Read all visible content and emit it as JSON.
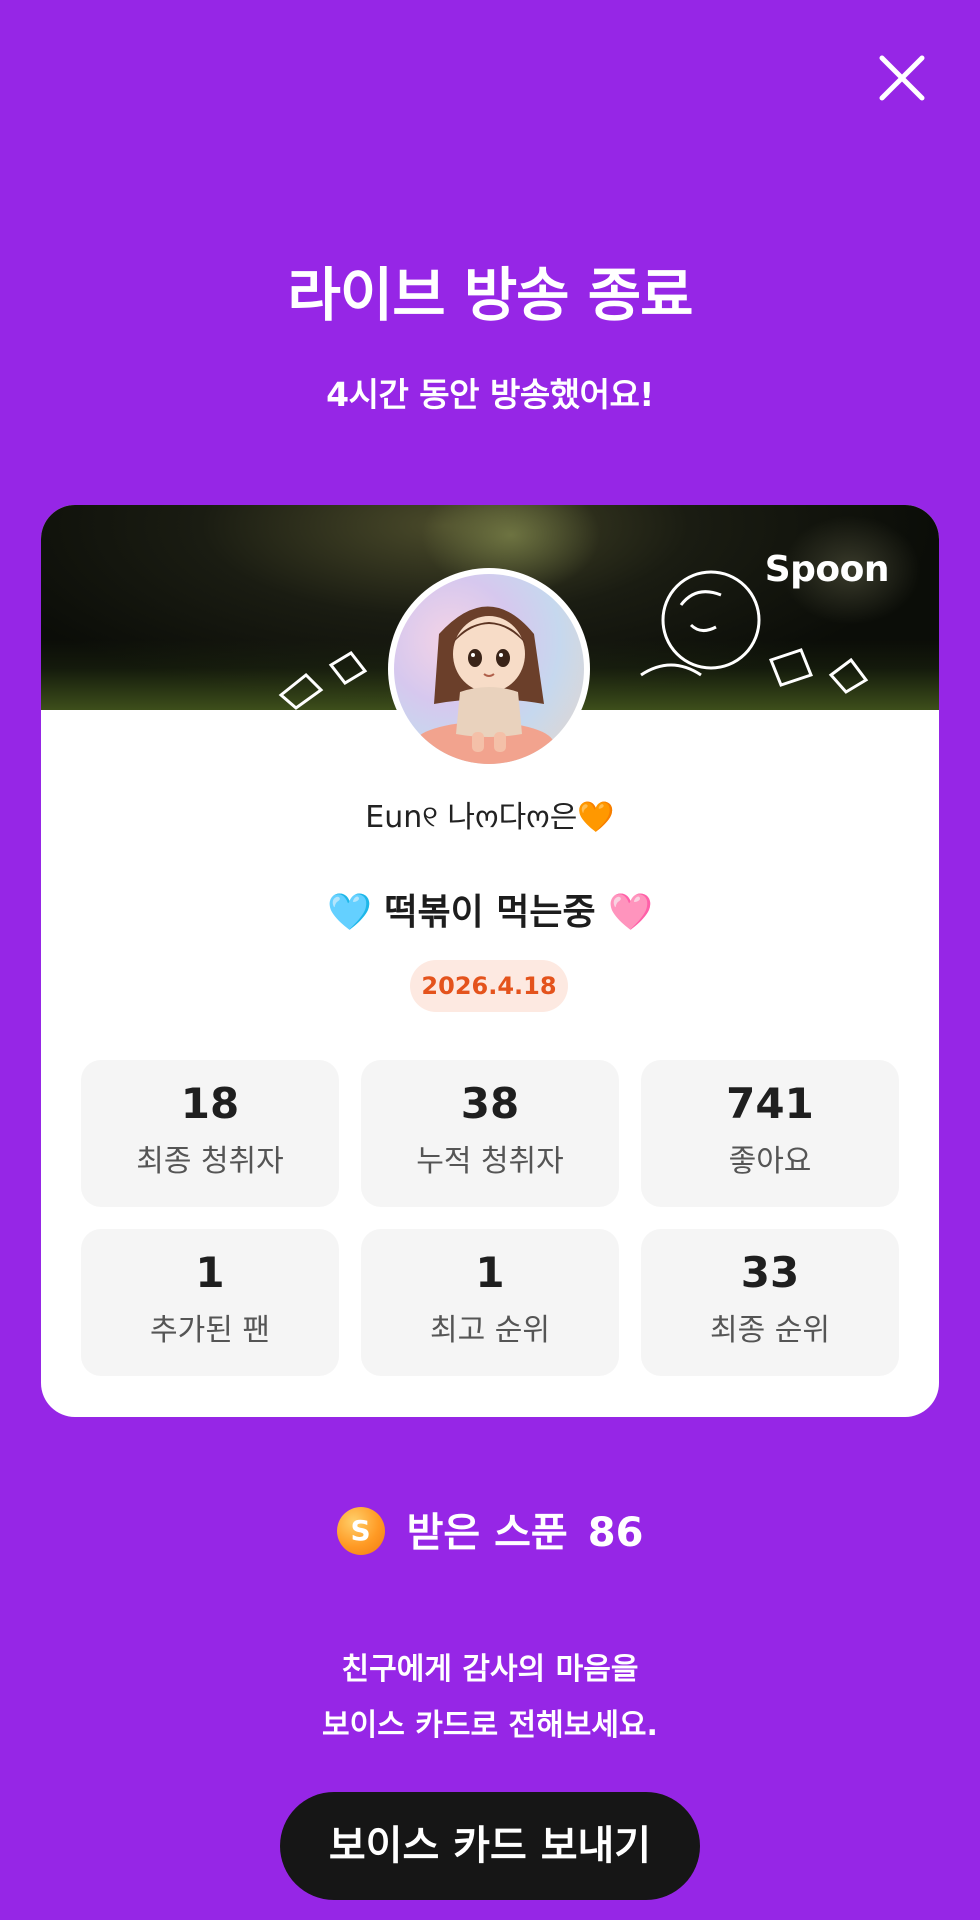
{
  "header": {
    "title": "라이브 방송 종료",
    "subtitle": "4시간 동안 방송했어요!",
    "close_icon": "close-icon"
  },
  "card": {
    "brand": "Spoon",
    "nickname": "Eun୧ 나ო다ო은🧡",
    "room_title": "🩵 떡볶이 먹는중 🩷",
    "date": "2026.4.18",
    "stats": [
      {
        "value": "18",
        "label": "최종 청취자"
      },
      {
        "value": "38",
        "label": "누적 청취자"
      },
      {
        "value": "741",
        "label": "좋아요"
      },
      {
        "value": "1",
        "label": "추가된 팬"
      },
      {
        "value": "1",
        "label": "최고 순위"
      },
      {
        "value": "33",
        "label": "최종 순위"
      }
    ]
  },
  "spoons": {
    "coin_letter": "S",
    "label": "받은 스푼",
    "count": "86"
  },
  "message": {
    "line1": "친구에게 감사의 마음을",
    "line2": "보이스 카드로 전해보세요."
  },
  "cta": {
    "label": "보이스 카드 보내기"
  },
  "colors": {
    "background": "#9626e6",
    "date_text": "#e4531c",
    "date_bg": "#fde9e1",
    "button_bg": "#161616"
  }
}
